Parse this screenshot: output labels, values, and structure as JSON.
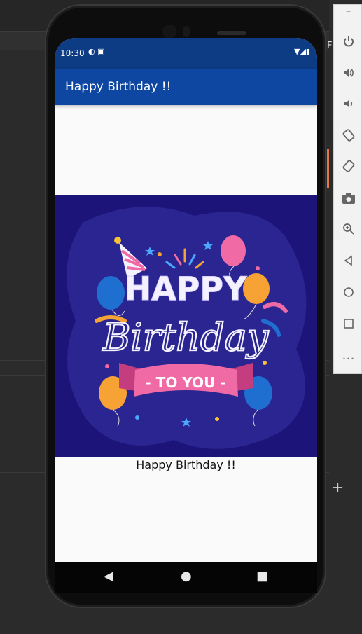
{
  "ide": {
    "plus_label": "+"
  },
  "side_toolbar": {
    "tab_label": "F",
    "items": [
      {
        "name": "minimize",
        "glyph": "–"
      },
      {
        "name": "power",
        "glyph": "⏻"
      },
      {
        "name": "volume-up",
        "glyph": "🔊"
      },
      {
        "name": "volume-down",
        "glyph": "🔉"
      },
      {
        "name": "rotate-left",
        "glyph": "⟲"
      },
      {
        "name": "rotate-right",
        "glyph": "⟳"
      },
      {
        "name": "screenshot",
        "glyph": "📷"
      },
      {
        "name": "zoom",
        "glyph": "⊕"
      },
      {
        "name": "back",
        "glyph": "◁"
      },
      {
        "name": "home",
        "glyph": "○"
      },
      {
        "name": "overview",
        "glyph": "□"
      },
      {
        "name": "more",
        "glyph": "…"
      }
    ]
  },
  "status_bar": {
    "time": "10:30",
    "left_icons": "◐ ▣",
    "right_icons": "▼◢▮"
  },
  "app_bar": {
    "title": "Happy Birthday !!"
  },
  "content": {
    "caption": "Happy Birthday !!",
    "banner": {
      "line1": "HAPPY",
      "line2": "Birthday",
      "ribbon": "- TO YOU -",
      "colors": {
        "bg": "#1d147a",
        "bg_light": "#2a2590",
        "pink": "#f06aa5",
        "blue": "#1f6fd1",
        "orange": "#f7a235"
      }
    }
  },
  "nav_bar": {
    "back": "◀",
    "home": "●",
    "recents": "■"
  }
}
